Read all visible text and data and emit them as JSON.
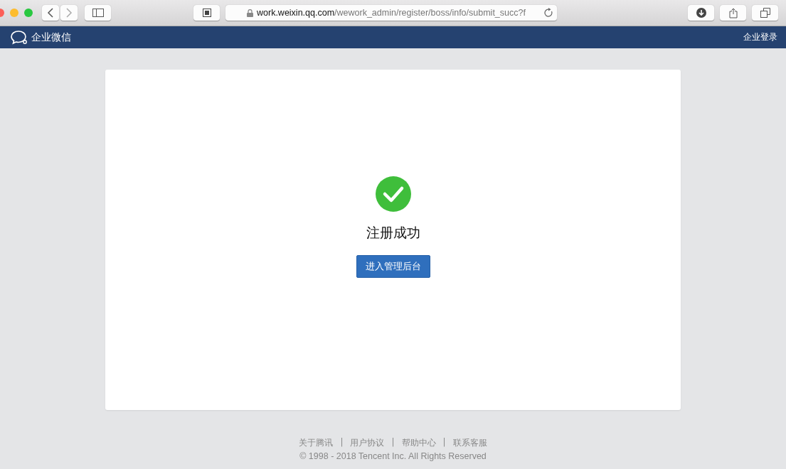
{
  "browser": {
    "url_host": "work.weixin.qq.com",
    "url_path": "/wework_admin/register/boss/info/submit_succ?f"
  },
  "header": {
    "brand": "企业微信",
    "login": "企业登录"
  },
  "card": {
    "title": "注册成功",
    "button": "进入管理后台"
  },
  "footer": {
    "links": [
      "关于腾讯",
      "用户协议",
      "帮助中心",
      "联系客服"
    ],
    "separator": "|",
    "copyright": "© 1998 - 2018 Tencent Inc. All Rights Reserved"
  }
}
